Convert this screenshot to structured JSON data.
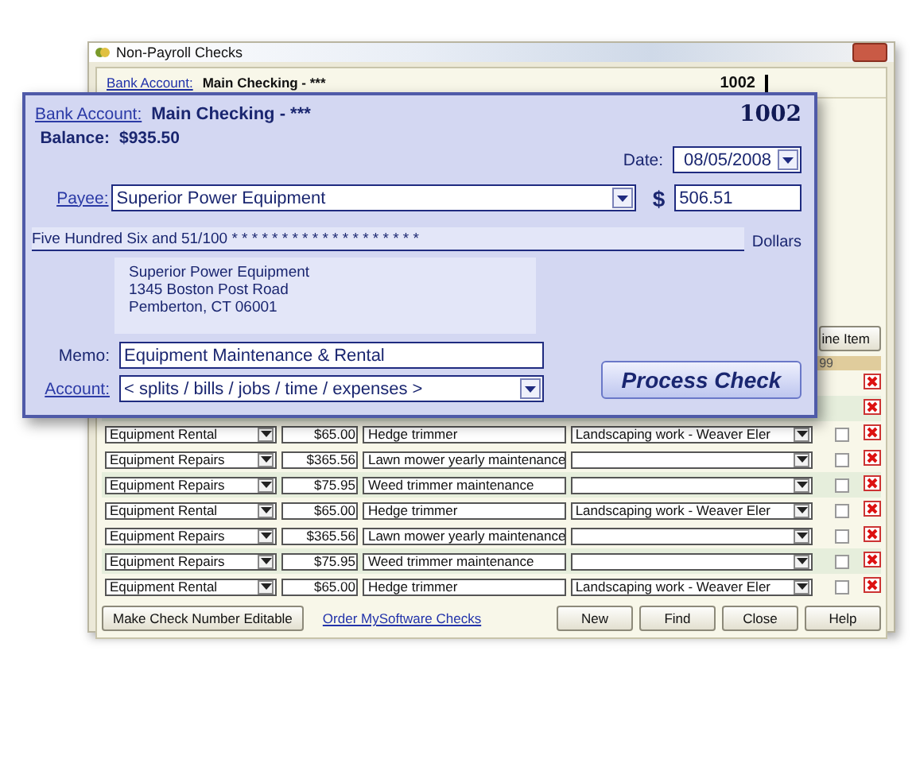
{
  "window": {
    "title": "Non-Payroll Checks"
  },
  "background_header": {
    "bank_account_link": "Bank Account:",
    "account": "Main Checking - ***",
    "check_number": "1002"
  },
  "line_item_button": "ine Item",
  "grid": {
    "column_header": "99",
    "rows": [
      {
        "kind": "covered"
      },
      {
        "kind": "covered"
      },
      {
        "kind": "line",
        "account": "Equipment Rental",
        "amount": "$65.00",
        "memo": "Hedge trimmer",
        "job": "Landscaping work - Weaver Eler",
        "checked": false
      },
      {
        "kind": "line",
        "account": "Equipment Repairs",
        "amount": "$365.56",
        "memo": "Lawn mower yearly maintenance",
        "job": "",
        "checked": false
      },
      {
        "kind": "line",
        "account": "Equipment Repairs",
        "amount": "$75.95",
        "memo": "Weed trimmer maintenance",
        "job": "",
        "checked": false
      },
      {
        "kind": "line",
        "account": "Equipment Rental",
        "amount": "$65.00",
        "memo": "Hedge trimmer",
        "job": "Landscaping work - Weaver Eler",
        "checked": false
      },
      {
        "kind": "line",
        "account": "Equipment Repairs",
        "amount": "$365.56",
        "memo": "Lawn mower yearly maintenance",
        "job": "",
        "checked": false
      },
      {
        "kind": "line",
        "account": "Equipment Repairs",
        "amount": "$75.95",
        "memo": "Weed trimmer maintenance",
        "job": "",
        "checked": false
      },
      {
        "kind": "line",
        "account": "Equipment Rental",
        "amount": "$65.00",
        "memo": "Hedge trimmer",
        "job": "Landscaping work - Weaver Eler",
        "checked": false
      }
    ]
  },
  "footer": {
    "editable_button": "Make Check Number Editable",
    "order_link": "Order MySoftware Checks",
    "buttons": [
      "New",
      "Find",
      "Close",
      "Help"
    ]
  },
  "check": {
    "bank_account_link": "Bank Account:",
    "account": "Main Checking - ***",
    "check_number": "1002",
    "balance_label": "Balance:",
    "balance": "$935.50",
    "date_label": "Date:",
    "date": "08/05/2008",
    "payee_link": "Payee:",
    "payee": "Superior Power Equipment",
    "currency": "$",
    "amount": "506.51",
    "amount_words": "Five Hundred Six and 51/100 * * * * * * * * * * * * * * * * * * *",
    "dollars": "Dollars",
    "address": [
      "Superior Power Equipment",
      "1345 Boston Post Road",
      "Pemberton, CT 06001"
    ],
    "memo_label": "Memo:",
    "memo": "Equipment Maintenance & Rental",
    "account_link": "Account:",
    "split_account": "< splits / bills / jobs / time / expenses >",
    "process_button": "Process Check"
  }
}
